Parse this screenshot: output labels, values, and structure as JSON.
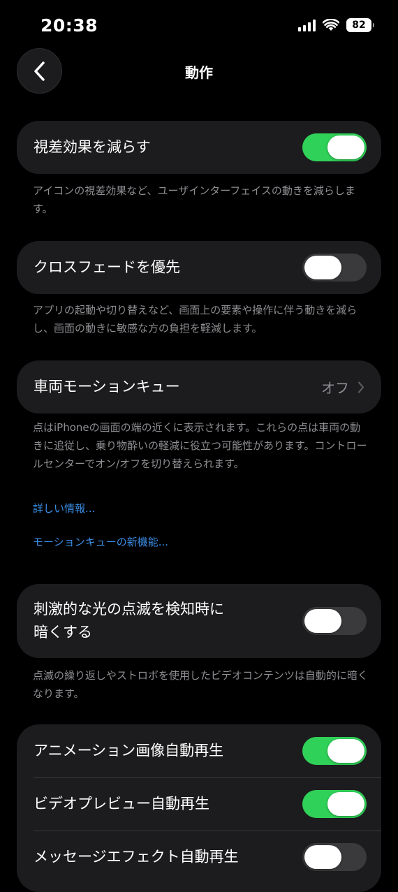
{
  "status_bar": {
    "time": "20:38",
    "battery": "82"
  },
  "nav": {
    "title": "動作"
  },
  "reduce_motion": {
    "label": "視差効果を減らす",
    "on": true,
    "footnote": "アイコンの視差効果など、ユーザインターフェイスの動きを減らします。"
  },
  "cross_fade": {
    "label": "クロスフェードを優先",
    "on": false,
    "footnote": "アプリの起動や切り替えなど、画面上の要素や操作に伴う動きを減らし、画面の動きに敏感な方の負担を軽減します。"
  },
  "vehicle_motion": {
    "label": "車両モーションキュー",
    "value": "オフ",
    "footnote": "点はiPhoneの画面の端の近くに表示されます。これらの点は車両の動きに追従し、乗り物酔いの軽減に役立つ可能性があります。コントロールセンターでオン/オフを切り替えられます。",
    "link_more": "詳しい情報...",
    "link_new": "モーションキューの新機能..."
  },
  "dim_flashing": {
    "label_line1": "刺激的な光の点滅を検知時に",
    "label_line2": "暗くする",
    "on": false,
    "footnote": "点滅の繰り返しやストロボを使用したビデオコンテンツは自動的に暗くなります。"
  },
  "auto_play": {
    "animated_images": {
      "label": "アニメーション画像自動再生",
      "on": true
    },
    "video_previews": {
      "label": "ビデオプレビュー自動再生",
      "on": true
    },
    "message_effects": {
      "label": "メッセージエフェクト自動再生",
      "on": false
    }
  },
  "colors": {
    "toggle_on": "#30d158",
    "toggle_off": "#3a3a3c",
    "link": "#3a8ee6"
  }
}
